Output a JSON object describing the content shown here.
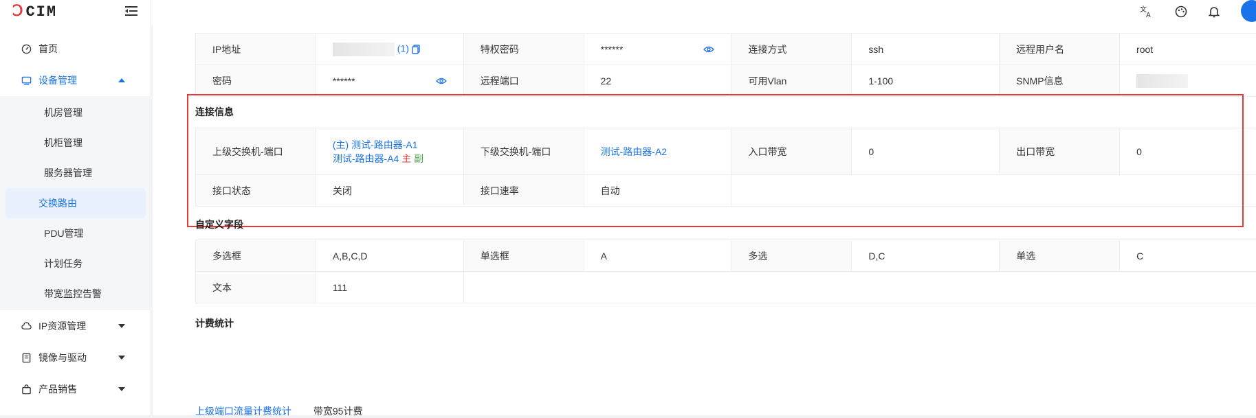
{
  "brand": {
    "logo_d": "Ↄ",
    "logo_rest": "CIM"
  },
  "sidebar": {
    "items": [
      {
        "label": "首页",
        "icon": "dashboard-icon"
      },
      {
        "label": "设备管理",
        "icon": "monitor-icon",
        "expanded": true
      },
      {
        "label": "IP资源管理",
        "icon": "cloud-icon"
      },
      {
        "label": "镜像与驱动",
        "icon": "disk-icon"
      },
      {
        "label": "产品销售",
        "icon": "bag-icon"
      }
    ],
    "sub_items": [
      "机房管理",
      "机柜管理",
      "服务器管理",
      "交换路由",
      "PDU管理",
      "计划任务",
      "带宽监控告警"
    ],
    "active_sub": "交换路由"
  },
  "topbar": {
    "icons": [
      "translate-icon",
      "palette-icon",
      "bell-icon"
    ]
  },
  "basic": {
    "ip_label": "IP地址",
    "ip_count": "(1)",
    "priv_label": "特权密码",
    "priv_value": "******",
    "conn_label": "连接方式",
    "conn_value": "ssh",
    "user_label": "远程用户名",
    "user_value": "root",
    "pwd_label": "密码",
    "pwd_value": "******",
    "port_label": "远程端口",
    "port_value": "22",
    "vlan_label": "可用Vlan",
    "vlan_value": "1-100",
    "snmp_label": "SNMP信息"
  },
  "conn": {
    "title": "连接信息",
    "up_label": "上级交换机-端口",
    "up_line1": "(主) 测试-路由器-A1",
    "up_line2": "测试-路由器-A4",
    "up_zhu": "主",
    "up_fu": "副",
    "down_label": "下级交换机-端口",
    "down_value": "测试-路由器-A2",
    "in_label": "入口带宽",
    "in_value": "0",
    "out_label": "出口带宽",
    "out_value": "0",
    "status_label": "接口状态",
    "status_value": "关闭",
    "rate_label": "接口速率",
    "rate_value": "自动"
  },
  "custom": {
    "title": "自定义字段",
    "multi_label": "多选框",
    "multi_value": "A,B,C,D",
    "single_label": "单选框",
    "single_value": "A",
    "multi2_label": "多选",
    "multi2_value": "D,C",
    "single2_label": "单选",
    "single2_value": "C",
    "text_label": "文本",
    "text_value": "111"
  },
  "billing": {
    "title": "计费统计",
    "tab_active": "上级端口流量计费统计",
    "tab_other": "带宽95计费"
  },
  "colors": {
    "accent": "#1a73e8",
    "highlight_border": "#e53935"
  }
}
